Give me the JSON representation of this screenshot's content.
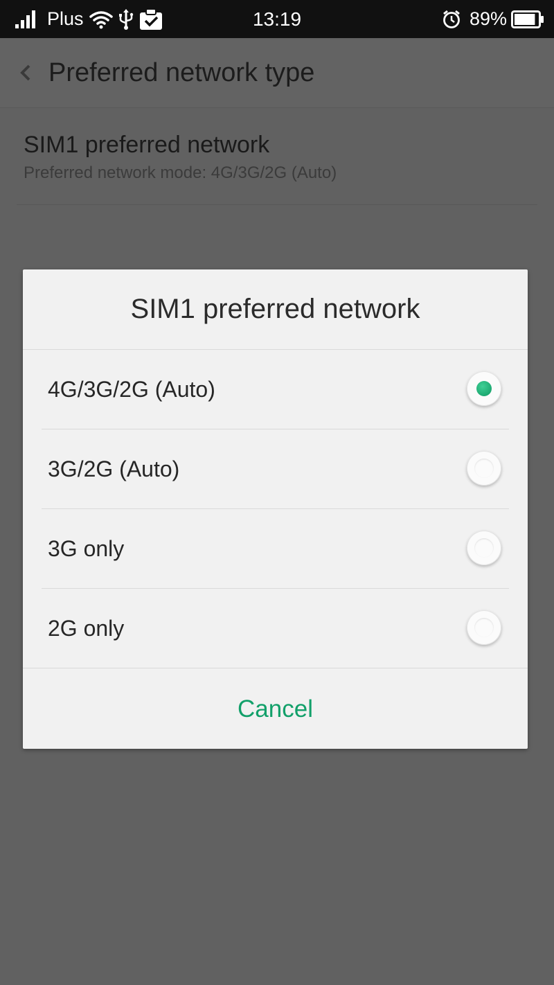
{
  "status_bar": {
    "carrier": "Plus",
    "time": "13:19",
    "battery_percent": "89%",
    "battery_level": 0.89,
    "icons": [
      "signal-icon",
      "wifi-icon",
      "usb-icon",
      "clipboard-check-icon",
      "alarm-icon",
      "battery-icon"
    ]
  },
  "app_bar": {
    "title": "Preferred network type",
    "back_icon": "chevron-left-icon"
  },
  "settings": {
    "sim1": {
      "title": "SIM1 preferred network",
      "summary": "Preferred network mode: 4G/3G/2G (Auto)"
    }
  },
  "dialog": {
    "title": "SIM1 preferred network",
    "options": [
      {
        "label": "4G/3G/2G (Auto)",
        "selected": true
      },
      {
        "label": "3G/2G (Auto)",
        "selected": false
      },
      {
        "label": "3G only",
        "selected": false
      },
      {
        "label": "2G only",
        "selected": false
      }
    ],
    "cancel_label": "Cancel"
  },
  "colors": {
    "accent": "#12a06a",
    "scrim_background": "#616161",
    "dialog_background": "#f1f1f1",
    "status_bar": "#111111"
  }
}
